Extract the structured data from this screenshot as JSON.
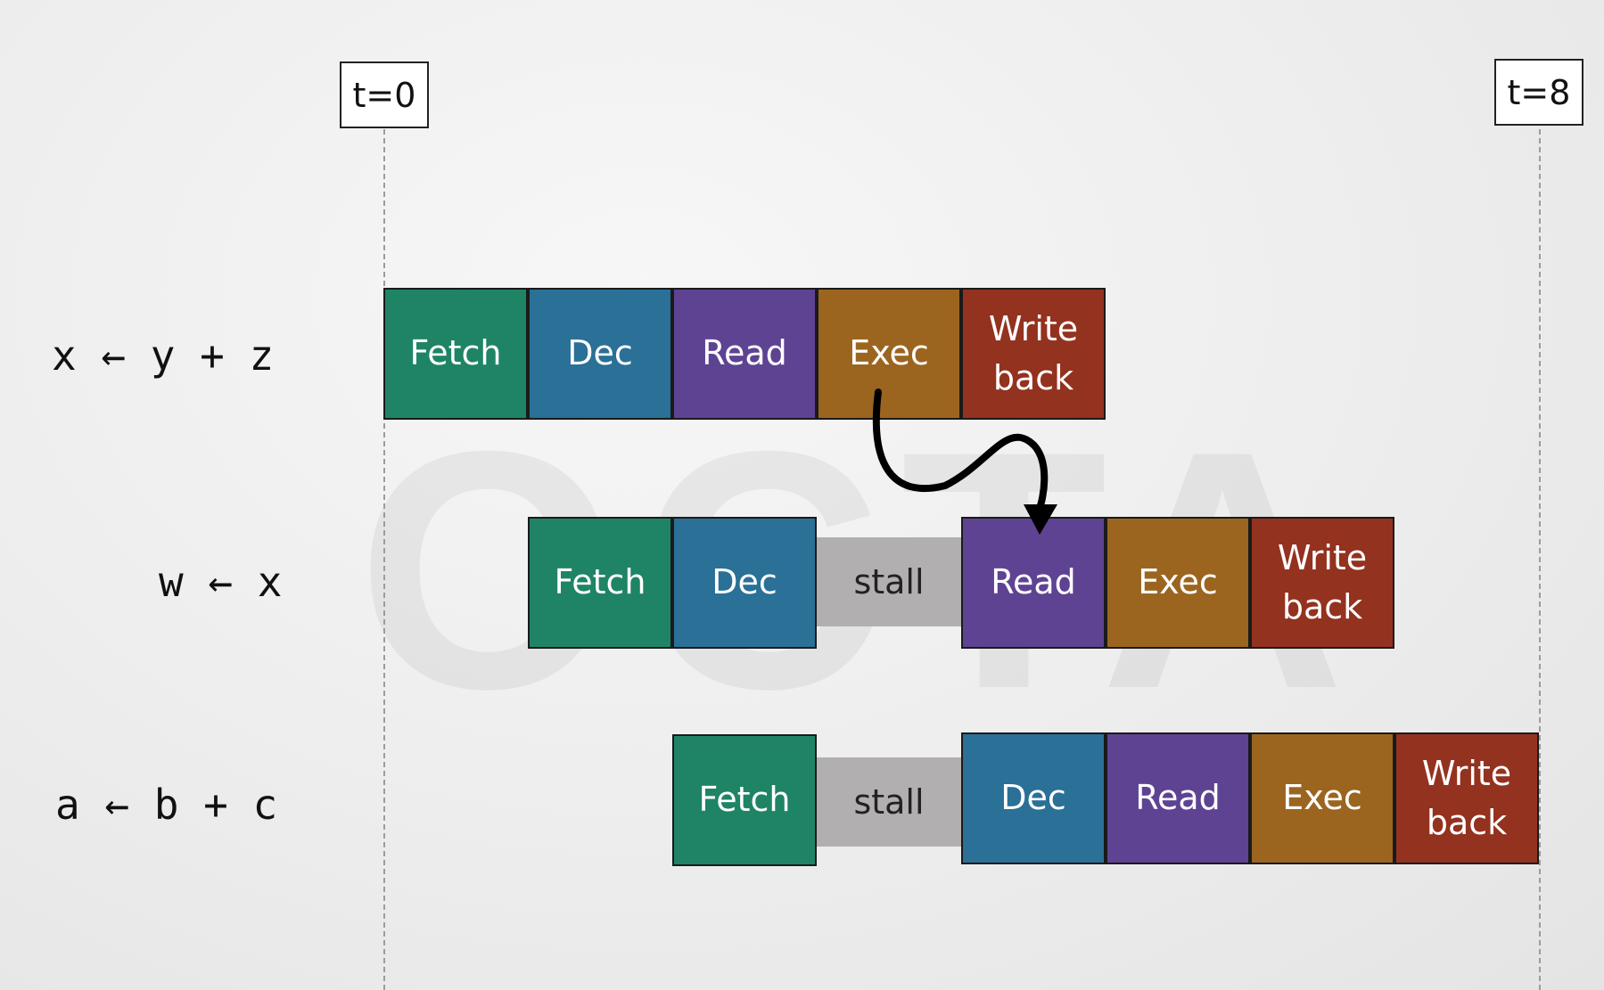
{
  "markers": {
    "start": "t=0",
    "end": "t=8"
  },
  "instructions": {
    "i1": "x ← y + z",
    "i2": "w ← x",
    "i3": "a ← b + c"
  },
  "stages": {
    "fetch": "Fetch",
    "dec": "Dec",
    "read": "Read",
    "exec": "Exec",
    "writeback": "Write back",
    "stall": "stall"
  },
  "colors": {
    "fetch": "#1f8466",
    "dec": "#2a7097",
    "read": "#5e4393",
    "exec": "#9b6520",
    "writeback": "#93321f",
    "stall": "#b2afb0"
  }
}
